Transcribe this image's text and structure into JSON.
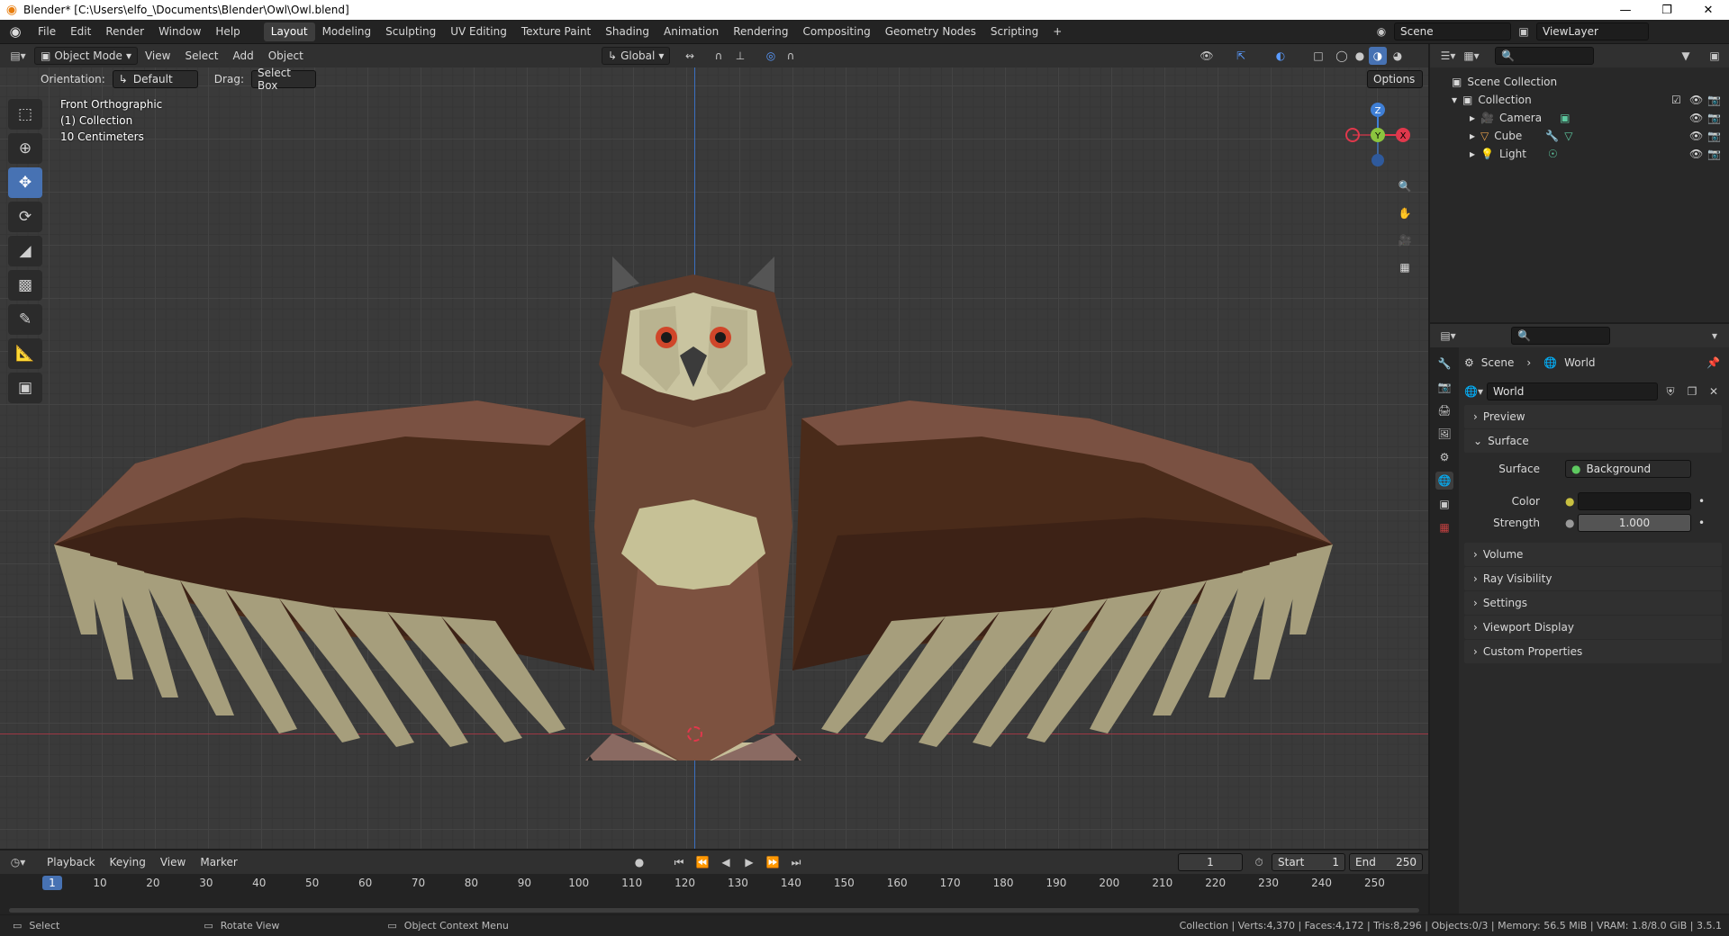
{
  "window": {
    "title": "Blender* [C:\\Users\\elfo_\\Documents\\Blender\\Owl\\Owl.blend]"
  },
  "menu": [
    "File",
    "Edit",
    "Render",
    "Window",
    "Help"
  ],
  "workspaces": [
    "Layout",
    "Modeling",
    "Sculpting",
    "UV Editing",
    "Texture Paint",
    "Shading",
    "Animation",
    "Rendering",
    "Compositing",
    "Geometry Nodes",
    "Scripting"
  ],
  "active_workspace": "Layout",
  "scene": "Scene",
  "view_layer": "ViewLayer",
  "viewport_header": {
    "mode": "Object Mode",
    "menus": [
      "View",
      "Select",
      "Add",
      "Object"
    ],
    "transform_orientation": "Global"
  },
  "tool_settings": {
    "orientation_label": "Orientation:",
    "orientation_value": "Default",
    "drag_label": "Drag:",
    "drag_value": "Select Box",
    "options": "Options"
  },
  "viewport_info": {
    "view": "Front Orthographic",
    "collection": "(1) Collection",
    "scale": "10 Centimeters"
  },
  "gizmo": {
    "x": "X",
    "y": "Y",
    "z": "Z"
  },
  "outliner": {
    "root": "Scene Collection",
    "collection": "Collection",
    "items": [
      "Camera",
      "Cube",
      "Light"
    ]
  },
  "properties": {
    "breadcrumb_scene": "Scene",
    "breadcrumb_world": "World",
    "world_name": "World",
    "panels": {
      "preview": "Preview",
      "surface": "Surface",
      "volume": "Volume",
      "ray_visibility": "Ray Visibility",
      "settings": "Settings",
      "viewport_display": "Viewport Display",
      "custom_properties": "Custom Properties"
    },
    "surface_label": "Surface",
    "surface_value": "Background",
    "color_label": "Color",
    "strength_label": "Strength",
    "strength_value": "1.000"
  },
  "timeline": {
    "menus": [
      "Playback",
      "Keying",
      "View",
      "Marker"
    ],
    "current_frame": "1",
    "start_label": "Start",
    "start_value": "1",
    "end_label": "End",
    "end_value": "250",
    "ruler": [
      "1",
      "10",
      "20",
      "30",
      "40",
      "50",
      "60",
      "70",
      "80",
      "90",
      "100",
      "110",
      "120",
      "130",
      "140",
      "150",
      "160",
      "170",
      "180",
      "190",
      "200",
      "210",
      "220",
      "230",
      "240",
      "250"
    ]
  },
  "status": {
    "left_action": "Select",
    "mid_action": "Rotate View",
    "ctx_action": "Object Context Menu",
    "stats": "Collection | Verts:4,370 | Faces:4,172 | Tris:8,296 | Objects:0/3 | Memory: 56.5 MiB | VRAM: 1.8/8.0 GiB | 3.5.1"
  },
  "colors": {
    "accent": "#4772b3",
    "x_axis": "#e0384c",
    "y_axis": "#8bc53f",
    "z_axis": "#3f7fd6",
    "orange": "#e87d0d"
  }
}
